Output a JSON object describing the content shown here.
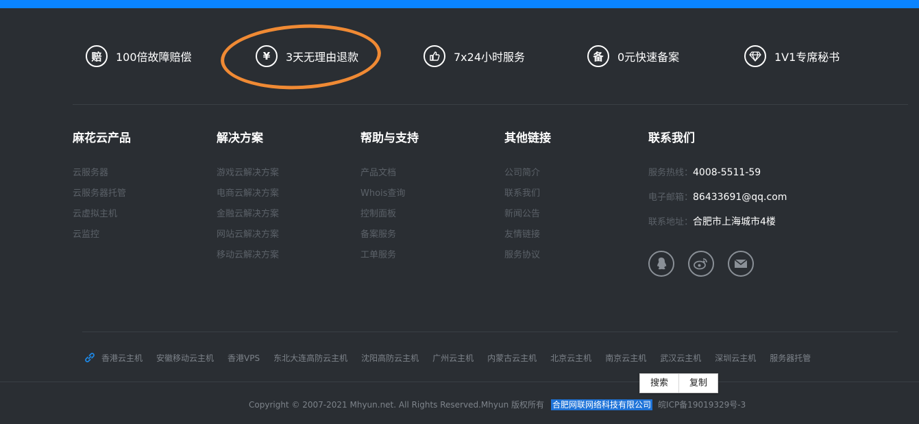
{
  "features": [
    {
      "icon": "赔",
      "label": "100倍故障赔偿"
    },
    {
      "icon": "¥",
      "label": "3天无理由退款"
    },
    {
      "icon": "thumbs-up-icon",
      "label": "7x24小时服务"
    },
    {
      "icon": "备",
      "label": "0元快速备案"
    },
    {
      "icon": "diamond-icon",
      "label": "1V1专席秘书"
    }
  ],
  "columns": [
    {
      "title": "麻花云产品",
      "items": [
        "云服务器",
        "云服务器托管",
        "云虚拟主机",
        "云监控"
      ]
    },
    {
      "title": "解决方案",
      "items": [
        "游戏云解决方案",
        "电商云解决方案",
        "金融云解决方案",
        "网站云解决方案",
        "移动云解决方案"
      ]
    },
    {
      "title": "帮助与支持",
      "items": [
        "产品文档",
        "Whois查询",
        "控制面板",
        "备案服务",
        "工单服务"
      ]
    },
    {
      "title": "其他链接",
      "items": [
        "公司简介",
        "联系我们",
        "新闻公告",
        "友情链接",
        "服务协议"
      ]
    }
  ],
  "contact": {
    "title": "联系我们",
    "hotline_label": "服务热线：",
    "hotline": "4008-5511-59",
    "email_label": "电子邮箱：",
    "email": "86433691@qq.com",
    "address_label": "联系地址：",
    "address": "合肥市上海城市4楼"
  },
  "friend_links": [
    "香港云主机",
    "安徽移动云主机",
    "香港VPS",
    "东北大连高防云主机",
    "沈阳高防云主机",
    "广州云主机",
    "内蒙古云主机",
    "北京云主机",
    "南京云主机",
    "武汉云主机",
    "深圳云主机",
    "服务器托管"
  ],
  "copyright": {
    "text": "Copyright © 2007-2021 Mhyun.net. All Rights Reserved.Mhyun 版权所有",
    "company": "合肥网联网络科技有限公司",
    "icp": "皖ICP备19019329号-3"
  },
  "popup": {
    "search": "搜索",
    "copy": "复制"
  },
  "colors": {
    "accent": "#0a84ff",
    "background": "#2a2e33",
    "highlight": "#1e73d8",
    "annotation": "#f08a34"
  }
}
